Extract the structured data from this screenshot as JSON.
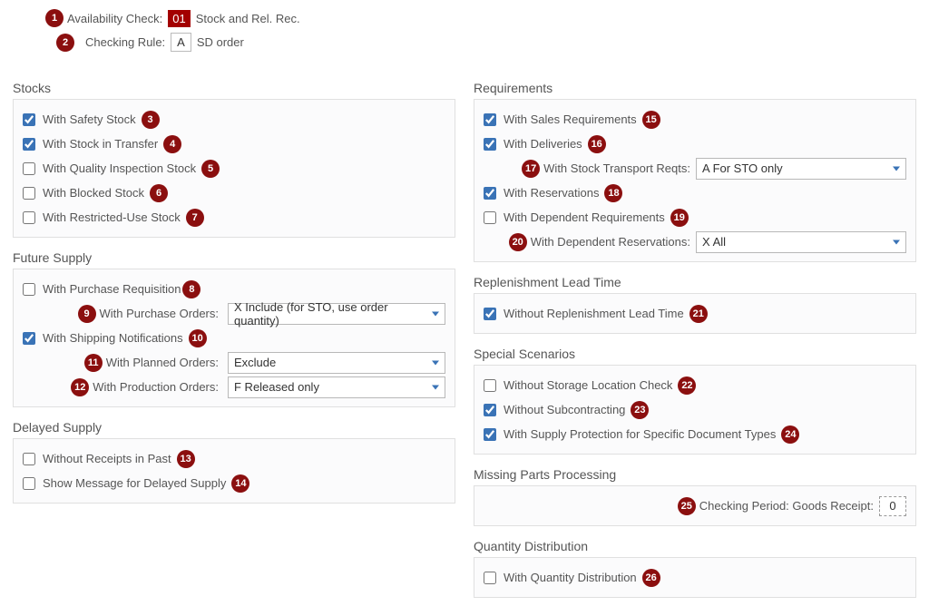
{
  "header": {
    "avail_label": "Availability Check:",
    "avail_code": "01",
    "avail_desc": "Stock and Rel. Rec.",
    "rule_label": "Checking Rule:",
    "rule_code": "A",
    "rule_desc": "SD order"
  },
  "markers": {
    "m1": "1",
    "m2": "2",
    "m3": "3",
    "m4": "4",
    "m5": "5",
    "m6": "6",
    "m7": "7",
    "m8": "8",
    "m9": "9",
    "m10": "10",
    "m11": "11",
    "m12": "12",
    "m13": "13",
    "m14": "14",
    "m15": "15",
    "m16": "16",
    "m17": "17",
    "m18": "18",
    "m19": "19",
    "m20": "20",
    "m21": "21",
    "m22": "22",
    "m23": "23",
    "m24": "24",
    "m25": "25",
    "m26": "26"
  },
  "stocks": {
    "title": "Stocks",
    "safety": "With Safety Stock",
    "transfer": "With Stock in Transfer",
    "quality": "With Quality Inspection Stock",
    "blocked": "With Blocked Stock",
    "restricted": "With Restricted-Use Stock"
  },
  "future": {
    "title": "Future Supply",
    "preq": "With Purchase Requisition",
    "po_label": "With Purchase Orders:",
    "po_value": "X Include (for STO, use order quantity)",
    "ship": "With Shipping Notifications",
    "plan_label": "With Planned Orders:",
    "plan_value": "Exclude",
    "prod_label": "With Production Orders:",
    "prod_value": "F Released only"
  },
  "delayed": {
    "title": "Delayed Supply",
    "past": "Without Receipts in Past",
    "msg": "Show Message for Delayed Supply"
  },
  "req": {
    "title": "Requirements",
    "sales": "With Sales Requirements",
    "deliv": "With Deliveries",
    "sto_label": "With Stock Transport Reqts:",
    "sto_value": "A For STO only",
    "resv": "With Reservations",
    "dep": "With Dependent Requirements",
    "depres_label": "With Dependent Reservations:",
    "depres_value": "X All"
  },
  "rlt": {
    "title": "Replenishment Lead Time",
    "without": "Without Replenishment Lead Time"
  },
  "special": {
    "title": "Special Scenarios",
    "noloc": "Without Storage Location Check",
    "nosub": "Without Subcontracting",
    "supply": "With Supply Protection for Specific Document Types"
  },
  "missing": {
    "title": "Missing Parts Processing",
    "label": "Checking Period: Goods Receipt:",
    "value": "0"
  },
  "qty": {
    "title": "Quantity Distribution",
    "with": "With Quantity Distribution"
  }
}
